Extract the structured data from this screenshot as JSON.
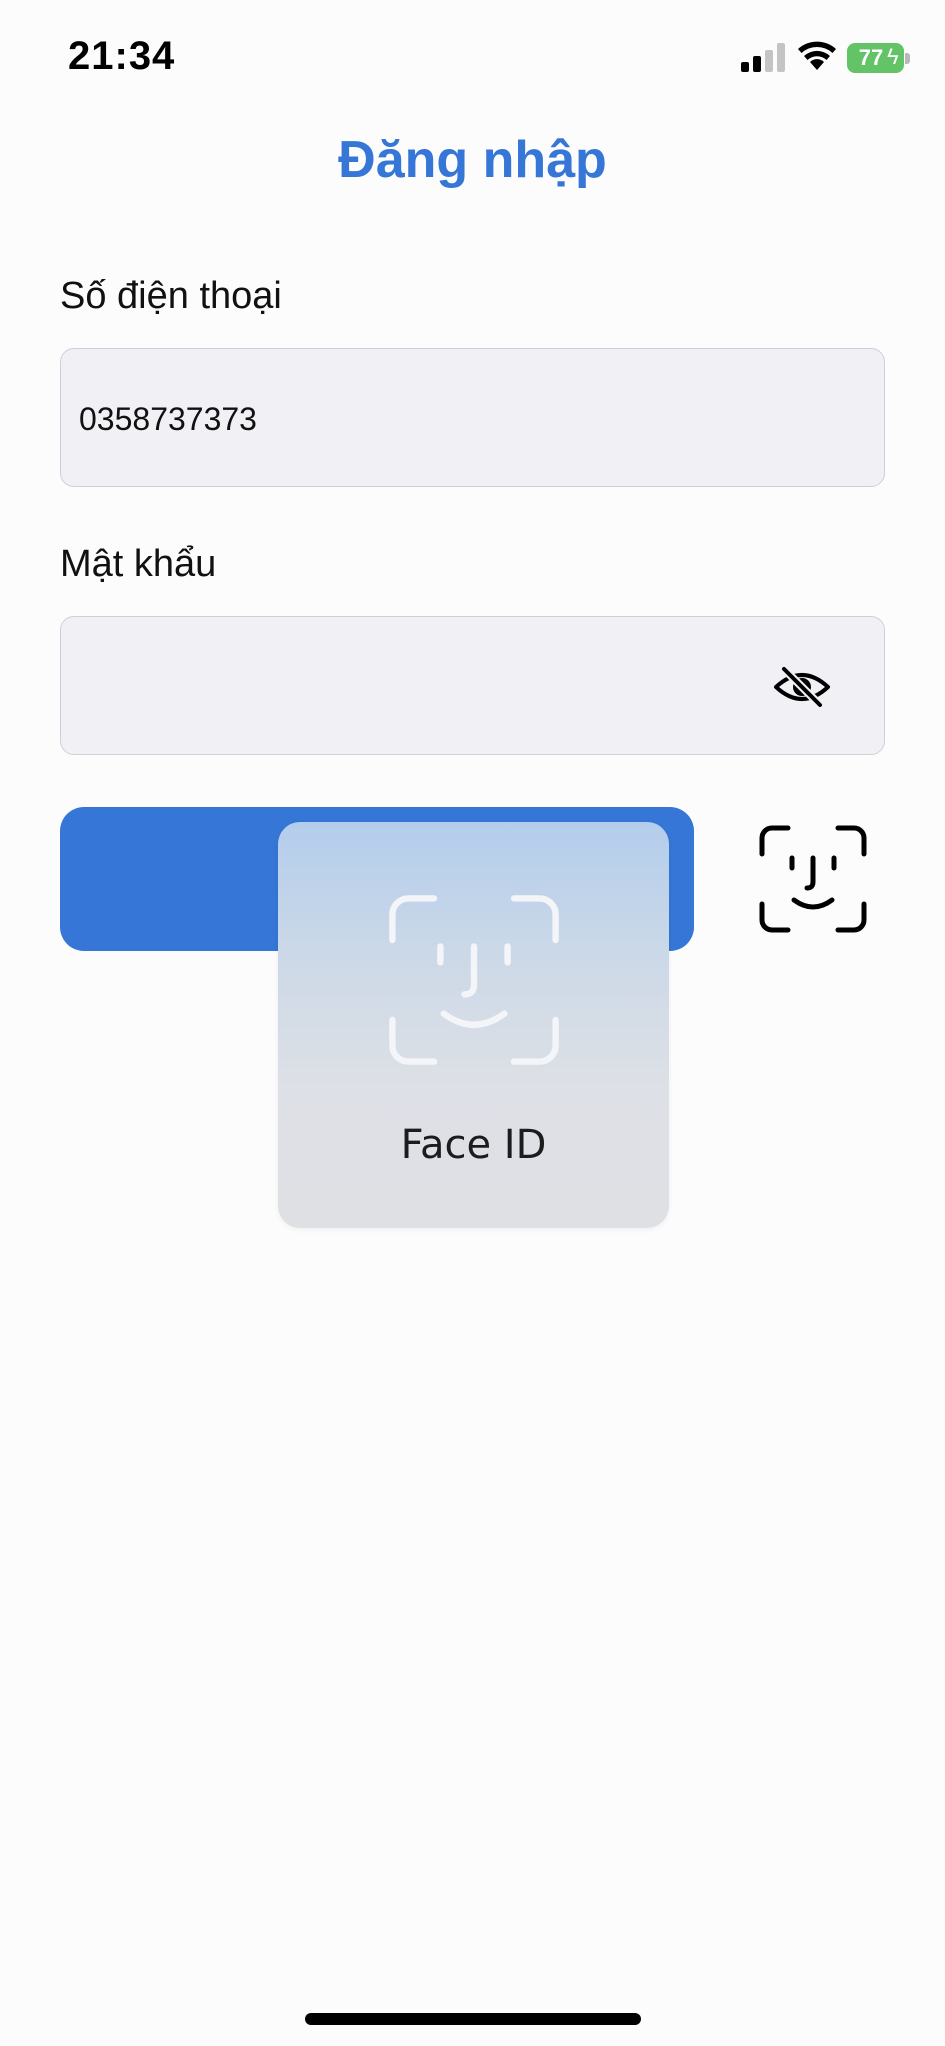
{
  "status_bar": {
    "time": "21:34",
    "battery_level": "77",
    "battery_color": "#62c466",
    "signal_bars_filled": 2,
    "signal_bars_total": 4
  },
  "page": {
    "title": "Đăng nhập"
  },
  "form": {
    "phone_label": "Số điện thoại",
    "phone_value": "0358737373",
    "password_label": "Mật khẩu",
    "password_value": "",
    "password_visibility_icon": "eye-slash-icon",
    "login_button_label": "",
    "faceid_button_icon": "face-id-icon"
  },
  "faceid_prompt": {
    "label": "Face ID",
    "icon": "face-id-icon"
  },
  "colors": {
    "accent": "#3576d6",
    "field_background": "#f0f0f5"
  }
}
